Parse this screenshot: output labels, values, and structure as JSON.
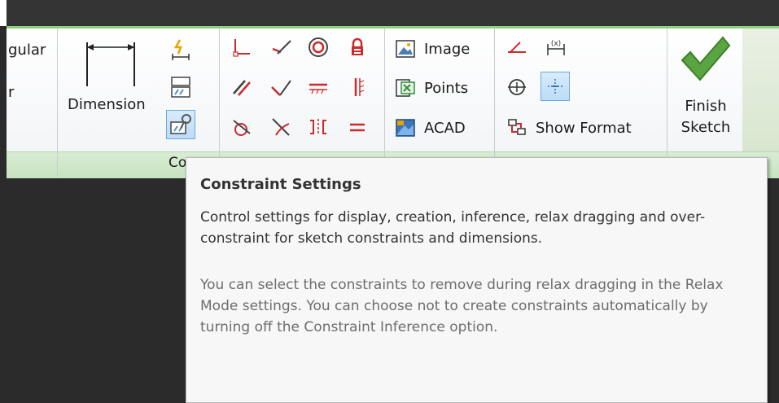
{
  "ribbon": {
    "partial_label_top": "gular",
    "partial_label_bottom": "r",
    "dimension_label": "Dimension",
    "panel_footer_partial": "Co",
    "insert_buttons": [
      {
        "label": "Image",
        "icon": "image-icon"
      },
      {
        "label": "Points",
        "icon": "points-icon"
      },
      {
        "label": "ACAD",
        "icon": "acad-icon"
      }
    ],
    "show_format_label": "Show Format",
    "finish_sketch": {
      "line1": "Finish",
      "line2": "Sketch",
      "icon": "checkmark-icon"
    }
  },
  "tooltip": {
    "title": "Constraint Settings",
    "description": "Control settings for display, creation, inference, relax dragging and over-constraint for sketch constraints and dimensions.",
    "note": "You can select the constraints to remove during relax dragging in the Relax Mode settings. You can choose not to create constraints automatically by turning off the Constraint Inference option."
  },
  "colors": {
    "accent_red": "#cc2a2a",
    "ribbon_green": "#8ed17c",
    "finish_check": "#5aa441",
    "highlight_blue": "#bcdcf8"
  }
}
